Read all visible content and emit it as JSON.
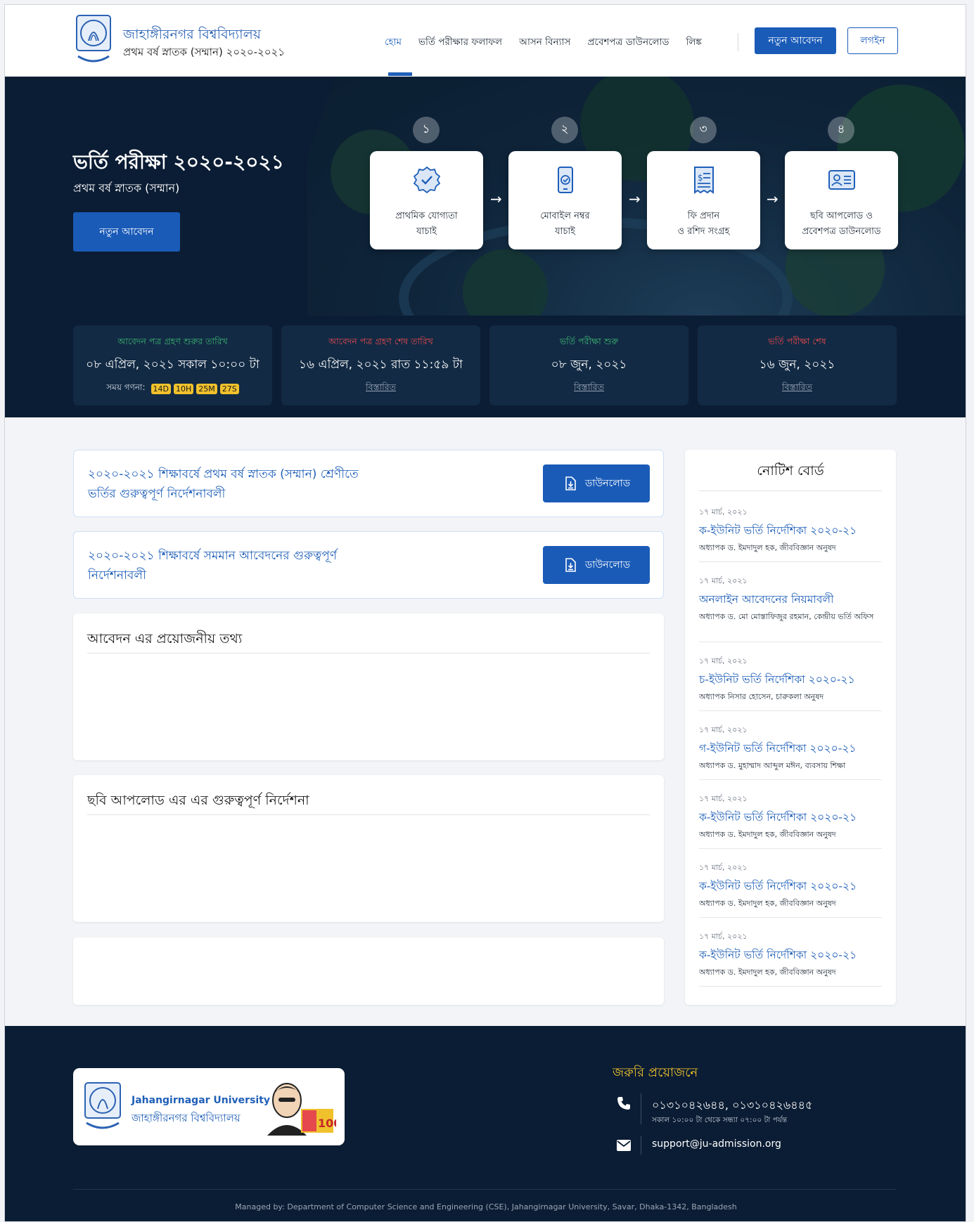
{
  "header": {
    "brand_title": "জাহাঙ্গীরনগর বিশ্ববিদ্যালয়",
    "brand_sub": "প্রথম বর্ষ স্নাতক (সম্মান) ২০২০-২০২১",
    "nav": [
      "হোম",
      "ভর্তি পরীক্ষার ফলাফল",
      "আসন বিন্যাস",
      "প্রবেশপত্র ডাউনলোড",
      "লিঙ্ক"
    ],
    "apply_label": "নতুন আবেদন",
    "login_label": "লগইন"
  },
  "hero": {
    "title": "ভর্তি পরীক্ষা ২০২০-২০২১",
    "subtitle": "প্রথম বর্ষ স্নাতক (সম্মান)",
    "button": "নতুন আবেদন",
    "steps": [
      {
        "num": "১",
        "line1": "প্রাথমিক যোগ্যতা",
        "line2": "যাচাই",
        "icon": "verified-badge-icon"
      },
      {
        "num": "২",
        "line1": "মোবাইল নম্বর",
        "line2": "যাচাই",
        "icon": "mobile-check-icon"
      },
      {
        "num": "৩",
        "line1": "ফি প্রদান",
        "line2": "ও রশিদ সংগ্রহ",
        "icon": "receipt-icon"
      },
      {
        "num": "৪",
        "line1": "ছবি আপলোড ও",
        "line2": "প্রবেশপত্র ডাউনলোড",
        "icon": "id-card-icon"
      }
    ]
  },
  "dates": [
    {
      "label": "আবেদন পত্র গ্রহণ শুরুর তারিখ",
      "value": "০৮ এপ্রিল, ২০২১ সকাল ১০:০০ টা",
      "color": "#3cb371"
    },
    {
      "label": "আবেদন পত্র গ্রহণ শেষ তারিখ",
      "value": "১৬ এপ্রিল, ২০২১ রাত ১১:৫৯ টা",
      "more": "বিস্তারিত",
      "color": "#e5484d"
    },
    {
      "label": "ভর্তি পরীক্ষা শুরু",
      "value": "০৮ জুন, ২০২১",
      "more": "বিস্তারিত",
      "color": "#3cb371"
    },
    {
      "label": "ভর্তি পরীক্ষা শেষ",
      "value": "১৬ জুন, ২০২১",
      "more": "বিস্তারিত",
      "color": "#e5484d"
    }
  ],
  "countdown": {
    "label": "সময় গণনা:",
    "d": "14D",
    "h": "10H",
    "m": "25M",
    "s": "27S"
  },
  "downloads": [
    {
      "line1": "২০২০-২০২১ শিক্ষাবর্ষে প্রথম বর্ষ স্নাতক (সম্মান) শ্রেণীতে",
      "line2": "ভর্তির গুরুত্বপূর্ণ নির্দেশনাবলী",
      "button": "ডাউনলোড"
    },
    {
      "line1": "২০২০-২০২১ শিক্ষাবর্ষে সমমান আবেদনের গুরুত্বপূর্ণ",
      "line2": "নির্দেশনাবলী",
      "button": "ডাউনলোড"
    }
  ],
  "info_cards": {
    "required_info": "আবেদন এর প্রয়োজনীয় তথ্য",
    "photo_upload": "ছবি আপলোড এর এর গুরুত্বপূর্ণ নির্দেশনা"
  },
  "notice": {
    "title": "নোটিশ বোর্ড",
    "items": [
      {
        "date": "১৭ মার্চ, ২০২১",
        "title": "ক-ইউনিট ভর্তি নির্দেশিকা ২০২০-২১",
        "author": "অধ্যাপক ড. ইমদাদুল হক, জীববিজ্ঞান অনুষদ"
      },
      {
        "date": "১৭ মার্চ, ২০২১",
        "title": "অনলাইন আবেদনের নিয়মাবলী",
        "author": "অধ্যাপক ড. মো মোস্তাফিজুর রহমান, কেন্দ্রীয় ভর্তি অফিস"
      },
      {
        "date": "১৭ মার্চ, ২০২১",
        "title": "চ-ইউনিট ভর্তি নির্দেশিকা ২০২০-২১",
        "author": "অধ্যাপক নিসার হোসেন, চারুকলা অনুষদ"
      },
      {
        "date": "১৭ মার্চ, ২০২১",
        "title": "গ-ইউনিট ভর্তি নির্দেশিকা ২০২০-২১",
        "author": "অধ্যাপক ড. মুহাম্মাদ আব্দুল মঈন, ব্যবসায় শিক্ষা"
      },
      {
        "date": "১৭ মার্চ, ২০২১",
        "title": "ক-ইউনিট ভর্তি নির্দেশিকা ২০২০-২১",
        "author": "অধ্যাপক ড. ইমদাদুল হক, জীববিজ্ঞান অনুষদ"
      },
      {
        "date": "১৭ মার্চ, ২০২১",
        "title": "ক-ইউনিট ভর্তি নির্দেশিকা ২০২০-২১",
        "author": "অধ্যাপক ড. ইমদাদুল হক, জীববিজ্ঞান অনুষদ"
      },
      {
        "date": "১৭ মার্চ, ২০২১",
        "title": "ক-ইউনিট ভর্তি নির্দেশিকা ২০২০-২১",
        "author": "অধ্যাপক ড. ইমদাদুল হক, জীববিজ্ঞান অনুষদ"
      }
    ]
  },
  "footer": {
    "logo_en": "Jahangirnagar University",
    "logo_bn": "জাহাঙ্গীরনগর বিশ্ববিদ্যালয়",
    "contact_title": "জরুরি প্রয়োজনে",
    "phone": "০১৩১০৪২৬৪৪, ০১৩১০৪২৬৪৪৫",
    "hours": "সকাল ১০:০০ টা থেকে সন্ধ্যা ০৭:০০ টা পর্যন্ত",
    "email": "support@ju-admission.org",
    "managed_by": "Managed by: Department of Computer Science and Engineering (CSE), Jahangirnagar University, Savar, Dhaka-1342, Bangladesh"
  },
  "colors": {
    "primary": "#1a5bb8",
    "navy": "#0b1d34",
    "accent": "#f0c12c"
  }
}
